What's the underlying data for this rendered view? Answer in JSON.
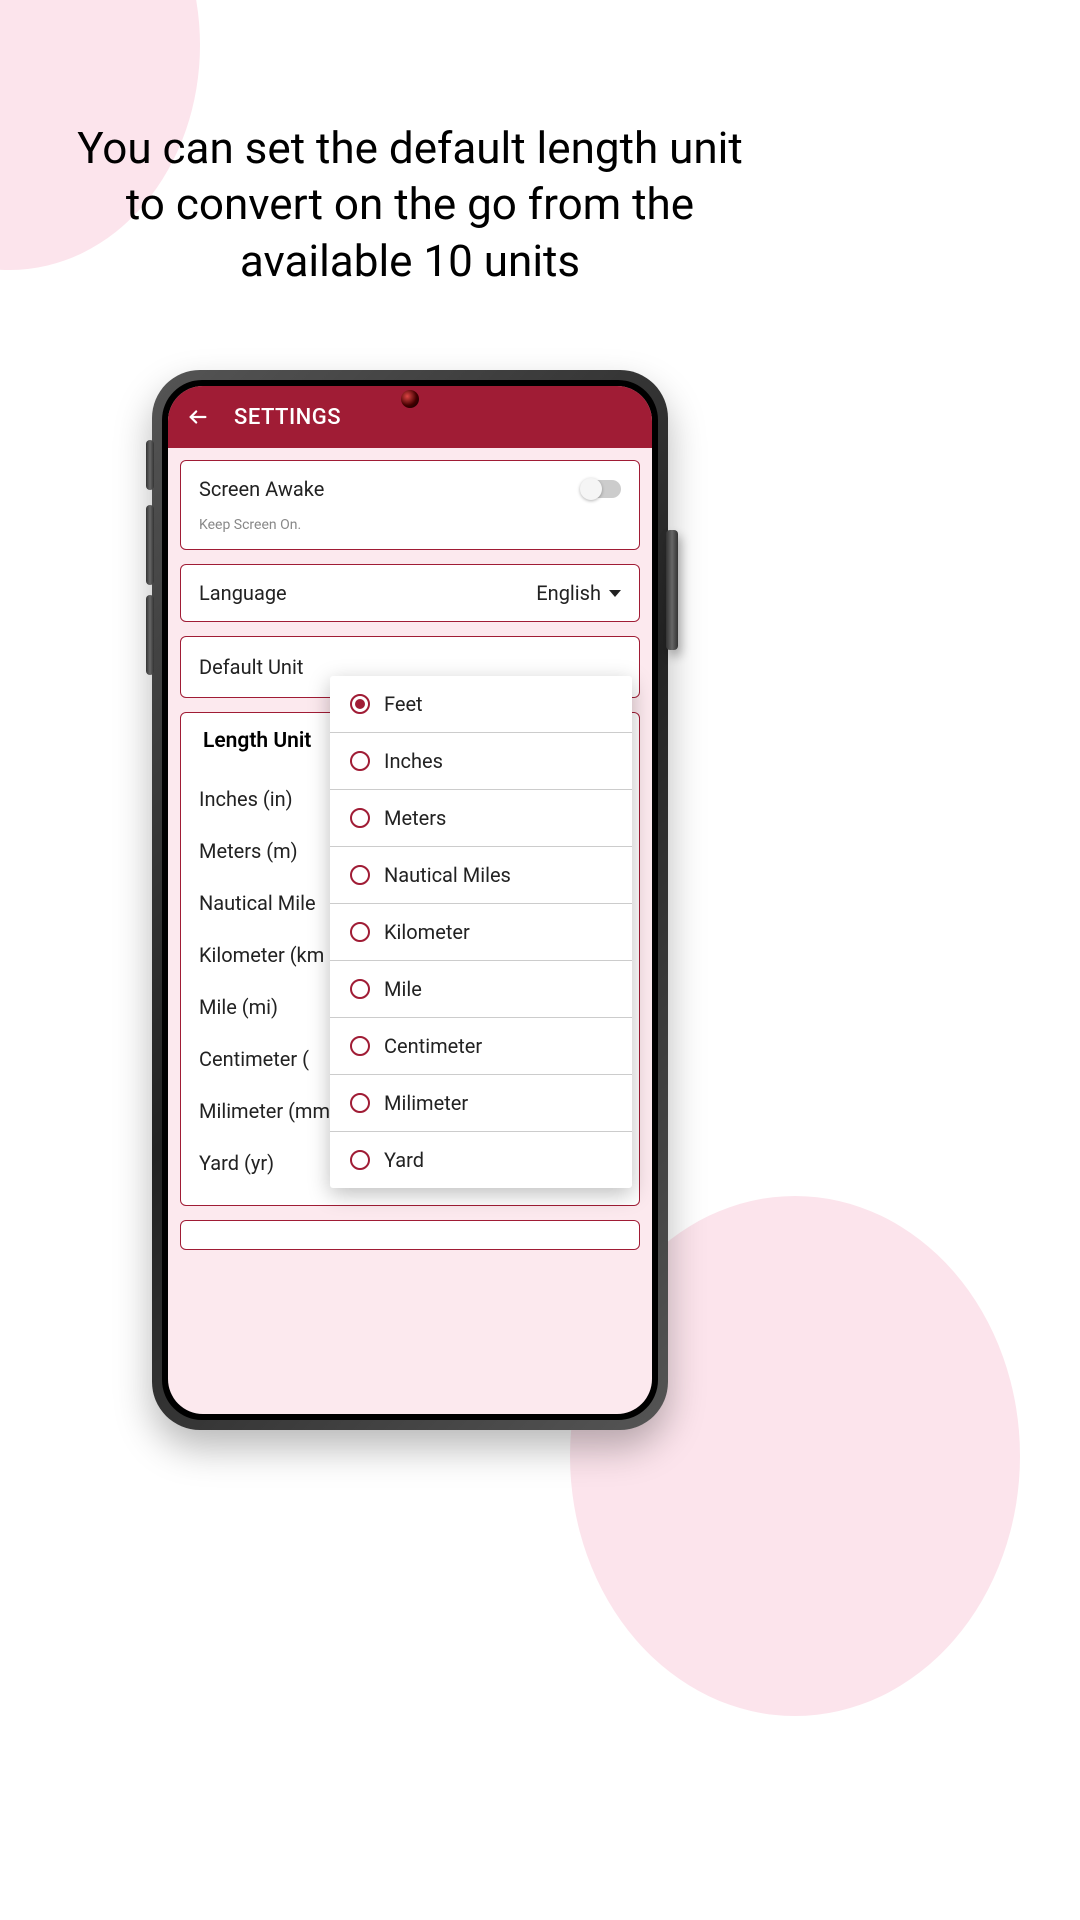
{
  "headline": "You can set the default length unit to convert on the go from the available 10 units",
  "appbar": {
    "title": "SETTINGS"
  },
  "screenAwake": {
    "title": "Screen Awake",
    "subtitle": "Keep Screen On."
  },
  "language": {
    "label": "Language",
    "value": "English"
  },
  "defaultUnit": {
    "label": "Default Unit"
  },
  "lengthUnits": {
    "header": "Length Unit",
    "items": [
      {
        "label": "Inches (in)"
      },
      {
        "label": "Meters (m)"
      },
      {
        "label": "Nautical Mile"
      },
      {
        "label": "Kilometer (km"
      },
      {
        "label": "Mile (mi)"
      },
      {
        "label": "Centimeter ("
      },
      {
        "label": "Milimeter (mm)"
      },
      {
        "label": "Yard (yr)"
      }
    ]
  },
  "popover": {
    "options": [
      {
        "label": "Feet",
        "selected": true
      },
      {
        "label": "Inches",
        "selected": false
      },
      {
        "label": "Meters",
        "selected": false
      },
      {
        "label": "Nautical Miles",
        "selected": false
      },
      {
        "label": "Kilometer",
        "selected": false
      },
      {
        "label": "Mile",
        "selected": false
      },
      {
        "label": "Centimeter",
        "selected": false
      },
      {
        "label": "Milimeter",
        "selected": false
      },
      {
        "label": "Yard",
        "selected": false
      }
    ]
  }
}
